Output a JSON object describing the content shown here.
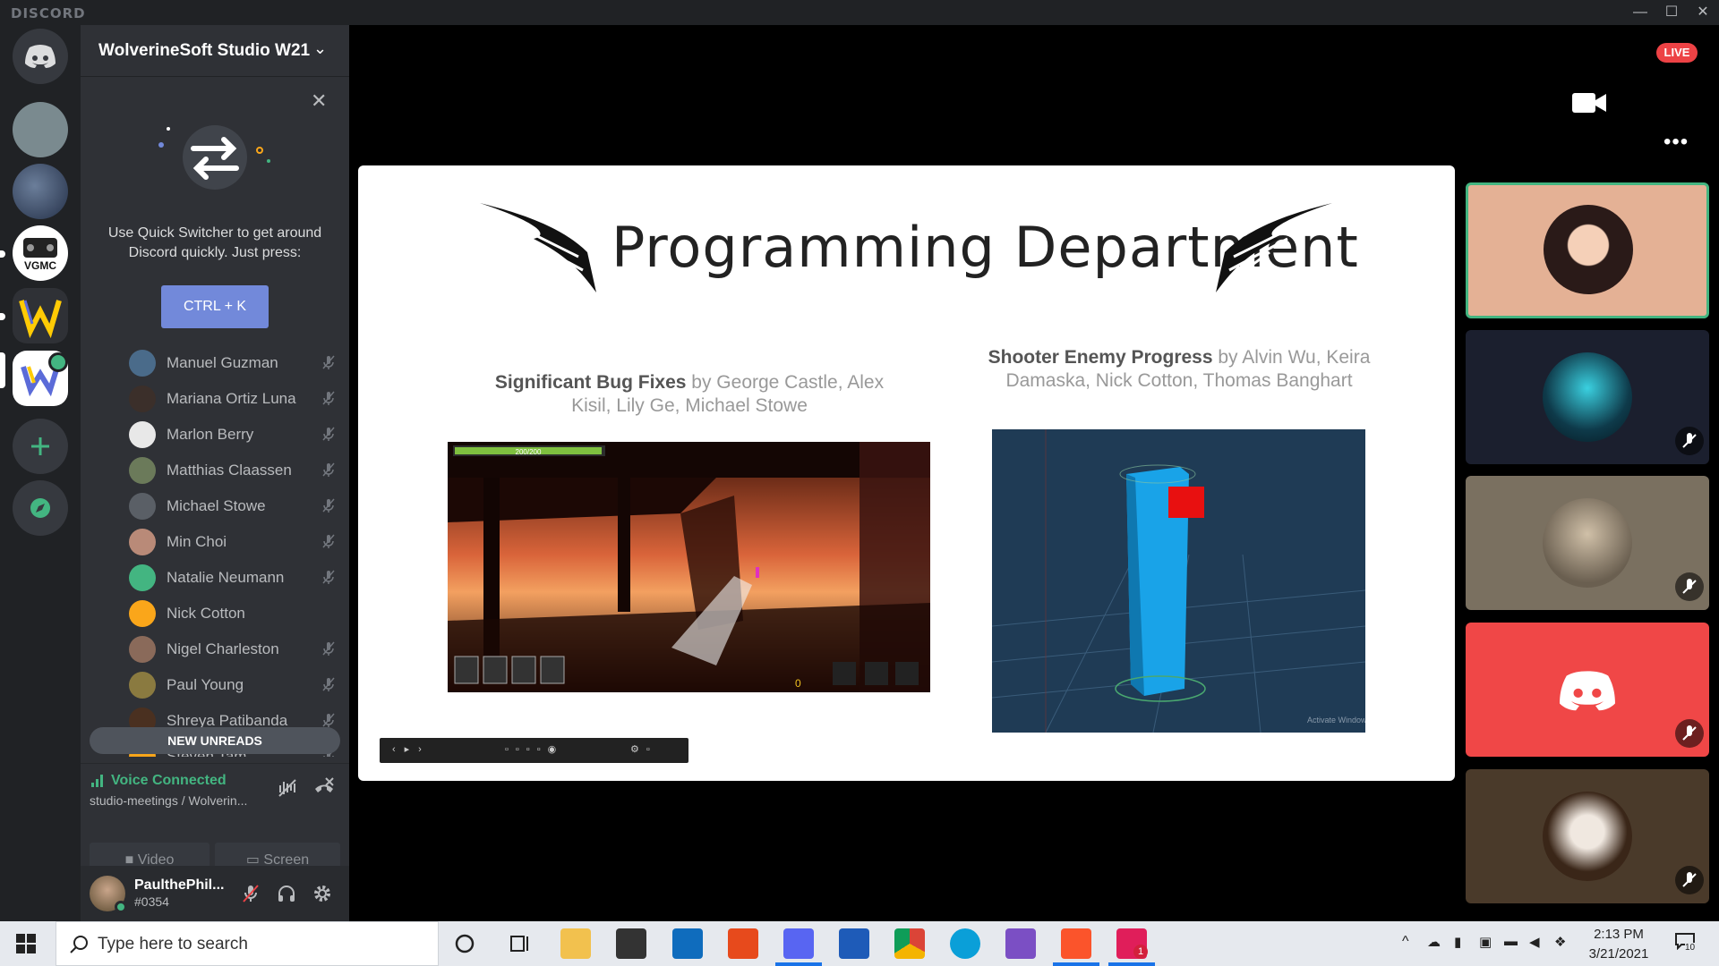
{
  "app": {
    "logo_text": "DISCORD"
  },
  "window": {
    "minimize": "—",
    "maximize": "☐",
    "close": "✕"
  },
  "guild": {
    "name": "WolverineSoft Studio W21"
  },
  "quick_switcher": {
    "text": "Use Quick Switcher to get around Discord quickly. Just press:",
    "shortcut": "CTRL + K"
  },
  "members": [
    {
      "name": "Manuel Guzman",
      "muted": true,
      "color": "#4a6b8a"
    },
    {
      "name": "Mariana Ortiz Luna",
      "muted": true,
      "color": "#3b2f2a"
    },
    {
      "name": "Marlon Berry",
      "muted": true,
      "color": "#e8e8e8"
    },
    {
      "name": "Matthias Claassen",
      "muted": true,
      "color": "#6b7a5a"
    },
    {
      "name": "Michael Stowe",
      "muted": true,
      "color": "#5a5f66"
    },
    {
      "name": "Min Choi",
      "muted": true,
      "color": "#b98a78"
    },
    {
      "name": "Natalie Neumann",
      "muted": true,
      "color": "#43b581"
    },
    {
      "name": "Nick Cotton",
      "muted": false,
      "color": "#faa61a"
    },
    {
      "name": "Nigel Charleston",
      "muted": true,
      "color": "#8a6a5a"
    },
    {
      "name": "Paul Young",
      "muted": true,
      "color": "#8a7a40"
    },
    {
      "name": "Shreya Patibanda",
      "muted": true,
      "color": "#4a3020"
    },
    {
      "name": "Steven Tam",
      "muted": true,
      "color": "#faa61a"
    }
  ],
  "new_unreads": "NEW UNREADS",
  "voice": {
    "status": "Voice Connected",
    "channel": "studio-meetings / Wolverin...",
    "video_label": "Video",
    "screen_label": "Screen"
  },
  "user": {
    "name": "PaulthePhil...",
    "tag": "#0354"
  },
  "stage": {
    "live_badge": "LIVE",
    "slide_title": "Programming Department",
    "left_caption_bold": "Significant Bug Fixes",
    "left_caption_rest": " by George Castle, Alex Kisil, Lily Ge, Michael Stowe",
    "right_caption_bold": "Shooter Enemy Progress",
    "right_caption_rest": " by Alvin Wu, Keira Damaska, Nick Cotton, Thomas Banghart",
    "hud_health": "200/200",
    "hud_ammo": "0",
    "watermark": "Activate Windows"
  },
  "taskbar": {
    "search_placeholder": "Type here to search",
    "time": "2:13 PM",
    "date": "3/21/2021",
    "notification_count": "10",
    "slack_badge": "1"
  },
  "colors": {
    "accent": "#7289da",
    "green": "#43b581",
    "red": "#ed4245"
  }
}
